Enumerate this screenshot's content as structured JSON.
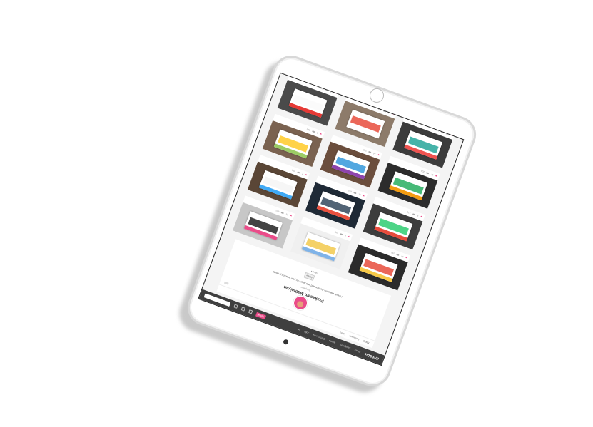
{
  "navbar": {
    "logo": "dribbble",
    "items": [
      "Shots",
      "Designers",
      "Teams",
      "Community",
      "Jobs",
      "•••"
    ],
    "upload_label": "Upload",
    "search_placeholder": ""
  },
  "profile": {
    "subnav": [
      "Shots",
      "Followers",
      "Likes"
    ],
    "name": "Prakasam Mathaiyan",
    "location": "Bangalore",
    "bio": "I create awesome Designs and web pages for your amazing projects.",
    "follow_label": "Follow",
    "more_label": "More ▾"
  },
  "shots": [
    {
      "colors": [
        "#2b2b2b",
        "#f7c948",
        "#e74c3c"
      ],
      "likes": "12",
      "views": "240"
    },
    {
      "colors": [
        "#f0f0f0",
        "#7fb3e8",
        "#f2c94c"
      ],
      "likes": "8",
      "views": "198"
    },
    {
      "colors": [
        "#c7c7c7",
        "#ea4c89",
        "#222222"
      ],
      "likes": "15",
      "views": "312"
    },
    {
      "colors": [
        "#3d3d3d",
        "#e74c3c",
        "#2ecc71"
      ],
      "likes": "9",
      "views": "176"
    },
    {
      "colors": [
        "#1f2a36",
        "#e9503e",
        "#34495e"
      ],
      "likes": "21",
      "views": "410"
    },
    {
      "colors": [
        "#5a4636",
        "#3fa9f5",
        "#f5f5f5"
      ],
      "likes": "7",
      "views": "150"
    },
    {
      "colors": [
        "#2c2c2c",
        "#f39c12",
        "#27ae60"
      ],
      "likes": "11",
      "views": "205"
    },
    {
      "colors": [
        "#6b4e3d",
        "#8e44ad",
        "#3498db"
      ],
      "likes": "14",
      "views": "288"
    },
    {
      "colors": [
        "#7a6250",
        "#9ccc65",
        "#ffca28"
      ],
      "likes": "6",
      "views": "133"
    },
    {
      "colors": [
        "#3c3c3c",
        "#ef5350",
        "#26a69a"
      ],
      "likes": "10",
      "views": "190"
    },
    {
      "colors": [
        "#8d7b6a",
        "#ffffff",
        "#e74c3c"
      ],
      "likes": "13",
      "views": "256"
    },
    {
      "colors": [
        "#4a4a4a",
        "#e53935",
        "#fafafa"
      ],
      "likes": "17",
      "views": "330"
    }
  ]
}
